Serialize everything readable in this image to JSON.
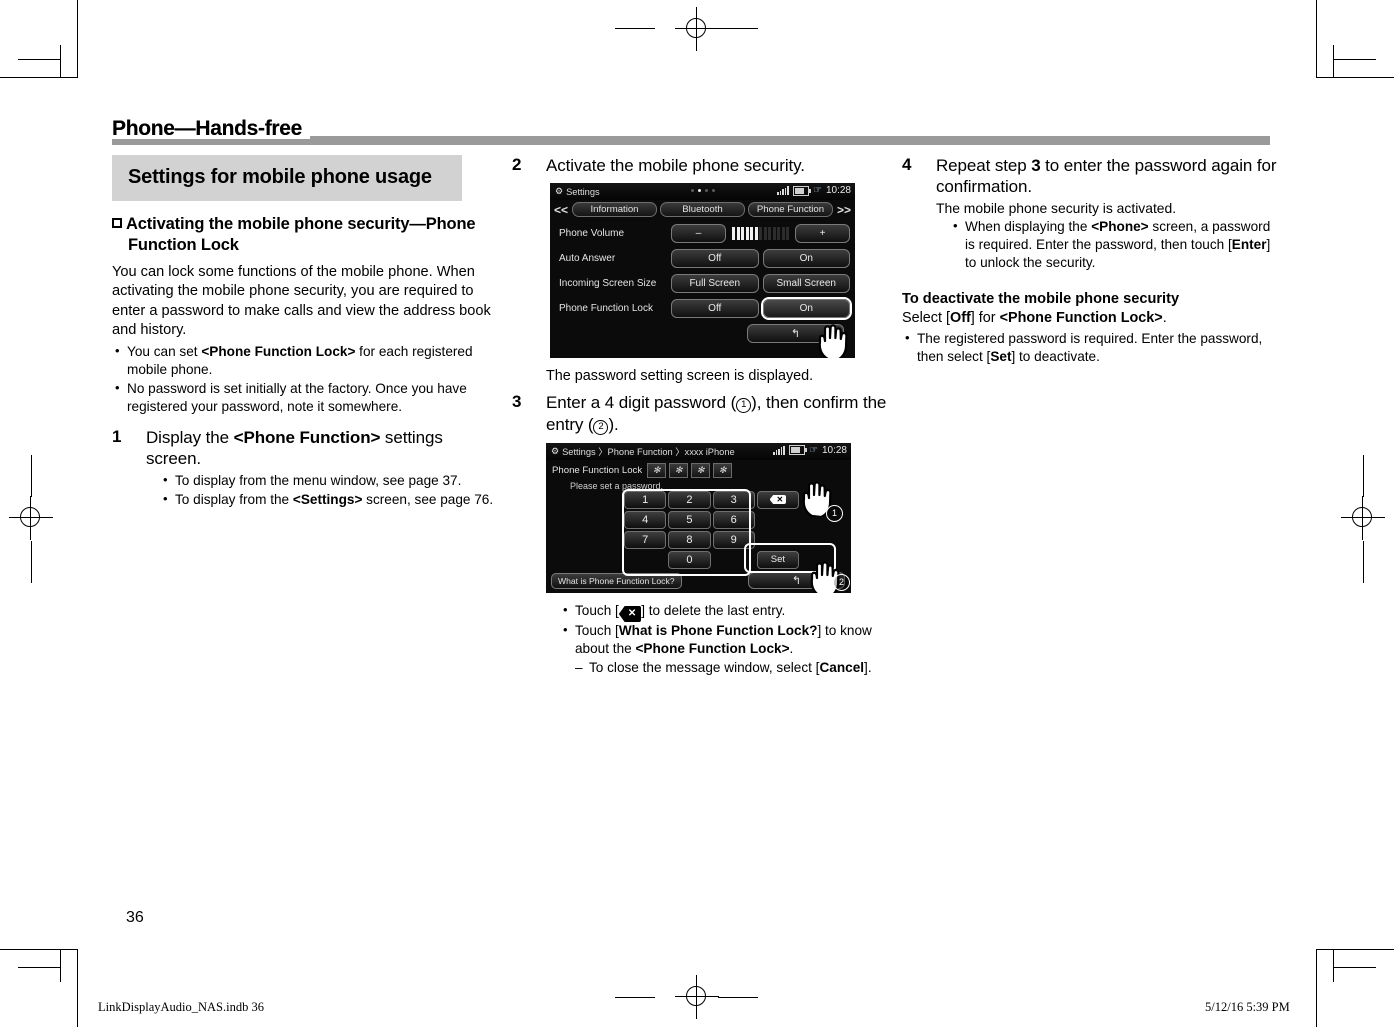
{
  "chapter": {
    "title": "Phone—Hands-free"
  },
  "section": {
    "title": "Settings for mobile phone usage"
  },
  "subsection": {
    "title": "Activating the mobile phone security—Phone Function Lock",
    "intro": "You can lock some functions of the mobile phone. When activating the mobile phone security, you are required to enter a password to make calls and view the address book and history.",
    "bullets": [
      "You can set <Phone Function Lock> for each registered mobile phone.",
      "No password is set initially at the factory. Once you have registered your password, note it somewhere."
    ]
  },
  "steps": [
    {
      "number": "1",
      "text": "Display the <Phone Function> settings screen.",
      "bullets": [
        "To display from the menu window, see page 37.",
        "To display from the <Settings> screen, see page 76."
      ]
    },
    {
      "number": "2",
      "text": "Activate the mobile phone security.",
      "caption": "The password setting screen is displayed."
    },
    {
      "number": "3",
      "text": "Enter a 4 digit password (①), then confirm the entry (②).",
      "bullets": [
        "Touch [ ⌫ ] to delete the last entry.",
        "Touch [What is Phone Function Lock?] to know about the <Phone Function Lock>."
      ],
      "subbullets": [
        "To close the message window, select [Cancel]."
      ]
    },
    {
      "number": "4",
      "text": "Repeat step 3 to enter the password again for confirmation.",
      "note": "The mobile phone security is activated.",
      "bullets": [
        "When displaying the <Phone> screen, a password is required. Enter the password, then touch [Enter] to unlock the security."
      ]
    }
  ],
  "deactivate": {
    "heading": "To deactivate the mobile phone security",
    "line": "Select [Off] for <Phone Function Lock>.",
    "bullets": [
      "The registered password is required. Enter the password, then select [Set] to deactivate."
    ]
  },
  "screen_settings": {
    "status": {
      "icon": "gear-icon",
      "title": "Settings",
      "dots": 4,
      "active_dot": 2,
      "signal": "signal-bars-icon",
      "battery": "battery-icon",
      "bluetooth": "bluetooth-icon",
      "time": "10:28"
    },
    "nav": {
      "prev": "<<",
      "next": ">>",
      "tabs": [
        "Information",
        "Bluetooth",
        "Phone Function"
      ],
      "active_tab": "Phone Function"
    },
    "rows": [
      {
        "label": "Phone Volume",
        "type": "volume",
        "minus": "–",
        "plus": "+",
        "segments": 13,
        "filled": 6
      },
      {
        "label": "Auto Answer",
        "type": "buttons",
        "options": [
          "Off",
          "On"
        ],
        "selected": ""
      },
      {
        "label": "Incoming Screen Size",
        "type": "buttons",
        "options": [
          "Full Screen",
          "Small Screen"
        ],
        "selected": ""
      },
      {
        "label": "Phone Function Lock",
        "type": "buttons",
        "options": [
          "Off",
          "On"
        ],
        "selected": "On"
      }
    ],
    "back_button": "↰"
  },
  "screen_keypad": {
    "status": {
      "icon": "gear-icon",
      "breadcrumb": "Settings 〉Phone Function 〉xxxx iPhone",
      "signal": "signal-bars-icon",
      "battery": "battery-icon",
      "bluetooth": "bluetooth-icon",
      "time": "10:28"
    },
    "field_label": "Phone Function Lock",
    "password_masks": [
      "✻",
      "✻",
      "✻",
      "✻"
    ],
    "prompt": "Please set a password.",
    "keys": [
      "1",
      "2",
      "3",
      "⌫",
      "4",
      "5",
      "6",
      "",
      "7",
      "8",
      "9",
      "",
      "",
      "0",
      "",
      "Set"
    ],
    "what_is_button": "What is Phone Function Lock?",
    "back_button": "↰",
    "callouts": [
      "1",
      "2"
    ]
  },
  "footer": {
    "page_number": "36",
    "file_name": "LinkDisplayAudio_NAS.indb   36",
    "timestamp": "5/12/16   5:39 PM"
  },
  "colors": {
    "rule": "#9a9a9a",
    "section_box": "#d2d2d2",
    "screen_bg": "#0b0b0b"
  }
}
